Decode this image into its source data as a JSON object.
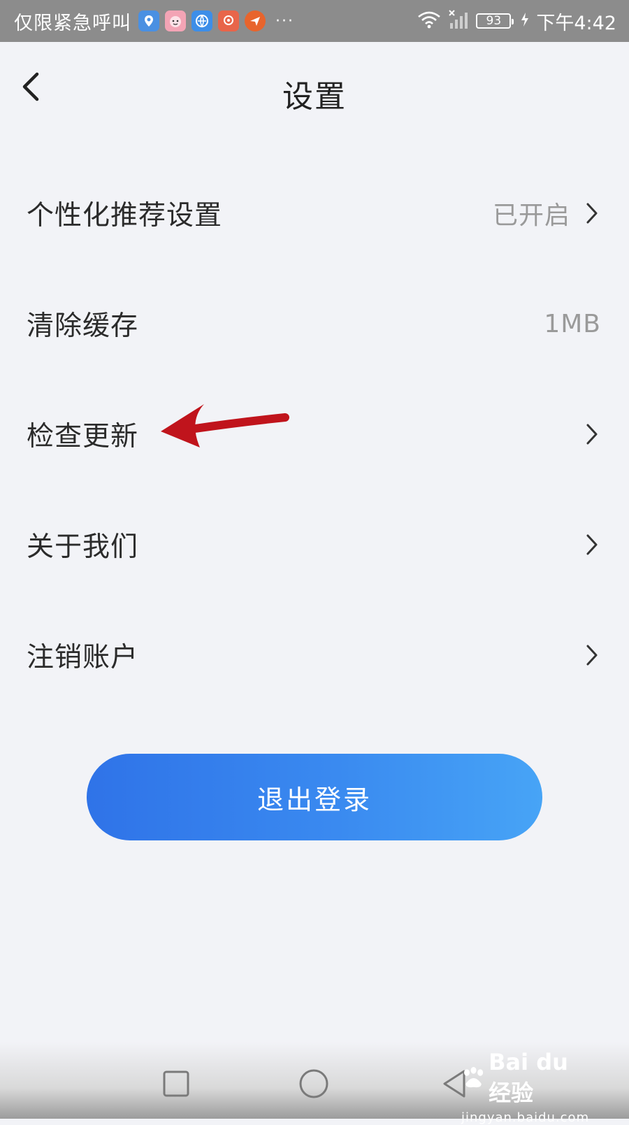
{
  "status_bar": {
    "carrier": "仅限紧急呼叫",
    "more": "···",
    "battery": "93",
    "time": "下午4:42",
    "app_icons": [
      {
        "name": "map-app-icon",
        "color": "#4a90e2"
      },
      {
        "name": "cartoon-app-icon",
        "color": "#f3a4b5"
      },
      {
        "name": "browser-app-icon",
        "color": "#3d8ee8"
      },
      {
        "name": "mail-app-icon",
        "color": "#e8654a"
      },
      {
        "name": "send-app-icon",
        "color": "#e8642c"
      }
    ]
  },
  "header": {
    "title": "设置"
  },
  "settings": {
    "items": [
      {
        "label": "个性化推荐设置",
        "value": "已开启",
        "chevron": true
      },
      {
        "label": "清除缓存",
        "value": "1MB",
        "chevron": false
      },
      {
        "label": "检查更新",
        "value": "",
        "chevron": true
      },
      {
        "label": "关于我们",
        "value": "",
        "chevron": true
      },
      {
        "label": "注销账户",
        "value": "",
        "chevron": true
      }
    ]
  },
  "logout": {
    "label": "退出登录"
  },
  "watermark": {
    "logo_text": "Bai du 经验",
    "url": "jingyan.baidu.com"
  },
  "colors": {
    "background": "#f2f3f7",
    "accent_start": "#2f73e8",
    "accent_end": "#47a4f6",
    "annotation_arrow": "#c0141c"
  }
}
